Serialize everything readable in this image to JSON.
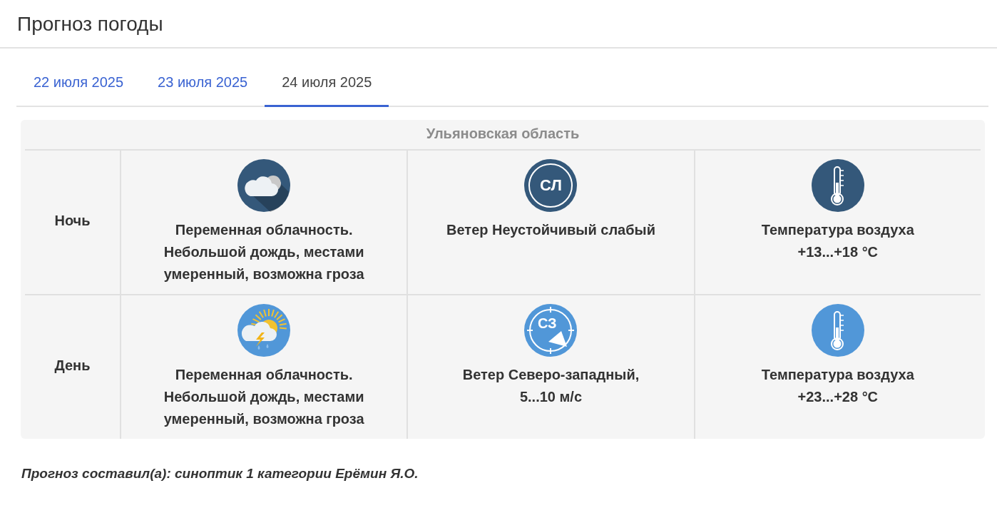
{
  "title": "Прогноз погоды",
  "tabs": [
    {
      "label": "22 июля 2025",
      "selected": false
    },
    {
      "label": "23 июля 2025",
      "selected": false
    },
    {
      "label": "24 июля 2025",
      "selected": true
    }
  ],
  "table": {
    "region": "Ульяновская область",
    "rows": [
      {
        "kind": "night",
        "period": "Ночь",
        "weather": {
          "kind": "cloud-night",
          "text": "Переменная облачность.\nНебольшой дождь, местами\nумеренный, возможна гроза"
        },
        "wind": {
          "kind": "calm",
          "code": "СЛ",
          "text": "Ветер Неустойчивый слабый"
        },
        "temperature": {
          "text": "Температура воздуха\n+13...+18 °C"
        }
      },
      {
        "kind": "day",
        "period": "День",
        "weather": {
          "kind": "sun-cloud-storm",
          "text": "Переменная облачность.\nНебольшой дождь, местами\nумеренный, возможна гроза"
        },
        "wind": {
          "kind": "direction",
          "code": "СЗ",
          "text": "Ветер Северо-западный,\n5...10 м/с"
        },
        "temperature": {
          "text": "Температура воздуха\n+23...+28 °C"
        }
      }
    ]
  },
  "footer": "Прогноз составил(а): синоптик 1 категории Ерёмин Я.О."
}
